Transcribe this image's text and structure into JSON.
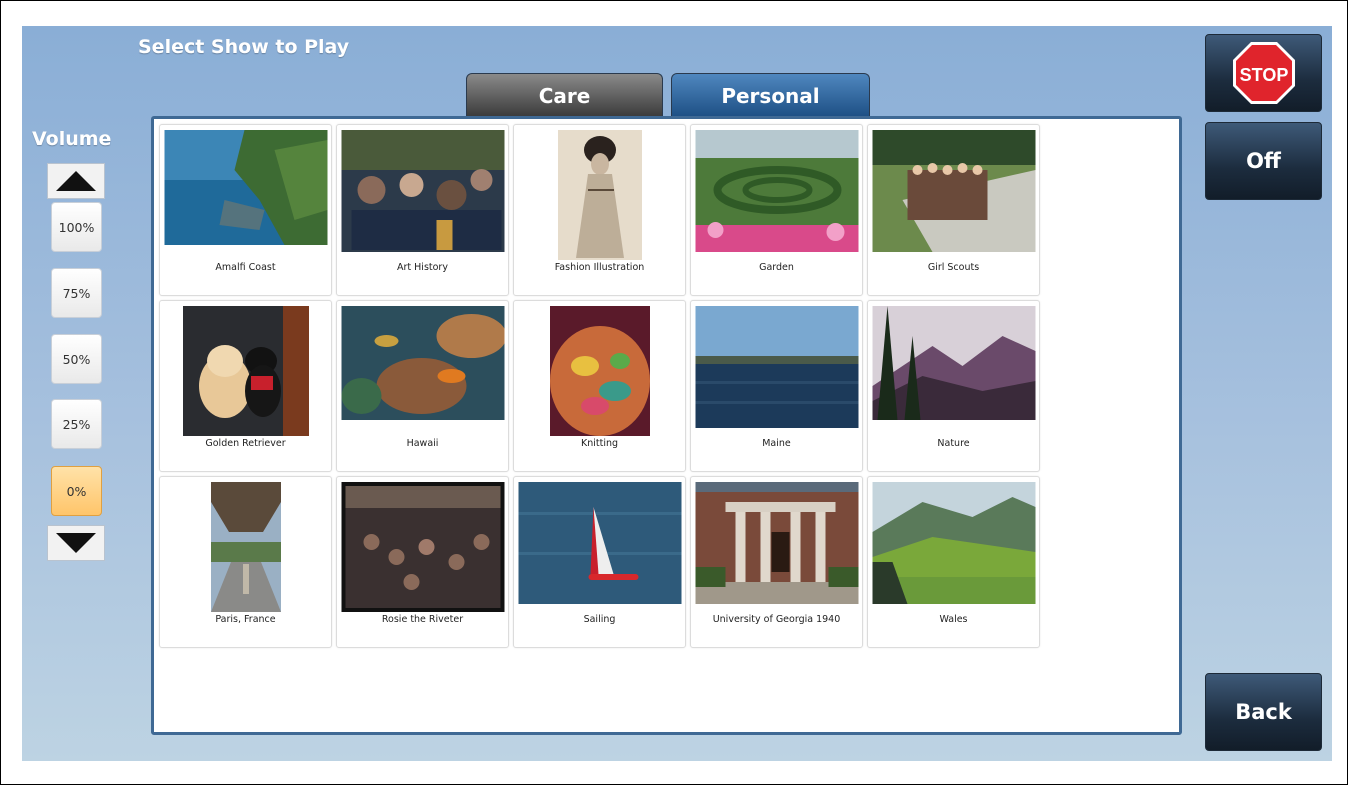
{
  "title": "Select Show to Play",
  "tabs": [
    {
      "label": "Care",
      "active": false
    },
    {
      "label": "Personal",
      "active": true
    }
  ],
  "volume": {
    "label": "Volume",
    "levels": [
      "100%",
      "75%",
      "50%",
      "25%",
      "0%"
    ],
    "selected": "0%"
  },
  "shows": [
    {
      "label": "Amalfi Coast"
    },
    {
      "label": "Art History"
    },
    {
      "label": "Fashion Illustration"
    },
    {
      "label": "Garden"
    },
    {
      "label": "Girl Scouts"
    },
    {
      "label": "Golden Retriever"
    },
    {
      "label": "Hawaii"
    },
    {
      "label": "Knitting"
    },
    {
      "label": "Maine"
    },
    {
      "label": "Nature"
    },
    {
      "label": "Paris, France"
    },
    {
      "label": "Rosie the Riveter"
    },
    {
      "label": "Sailing"
    },
    {
      "label": "University of Georgia 1940"
    },
    {
      "label": "Wales"
    }
  ],
  "controls": {
    "stop_label": "STOP",
    "off_label": "Off",
    "back_label": "Back"
  },
  "colors": {
    "stop_red": "#e0242c",
    "active_volume": "#ffc56a",
    "tab_active": "#2e6aa6",
    "tab_inactive": "#5a5a5a"
  }
}
